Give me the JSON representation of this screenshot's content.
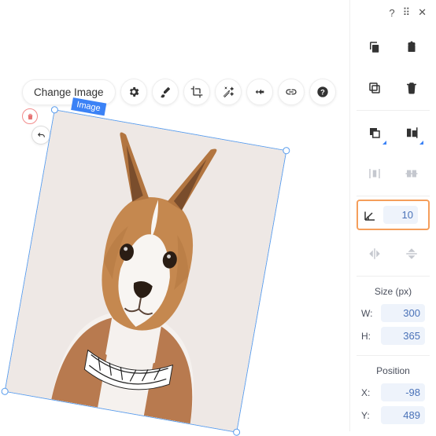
{
  "toolbar": {
    "change_image": "Change Image"
  },
  "selection": {
    "tag": "Image"
  },
  "panel": {
    "rotation": "10",
    "size_title": "Size (px)",
    "w_label": "W:",
    "h_label": "H:",
    "width": "300",
    "height": "365",
    "position_title": "Position",
    "x_label": "X:",
    "y_label": "Y:",
    "x": "-98",
    "y": "489"
  }
}
